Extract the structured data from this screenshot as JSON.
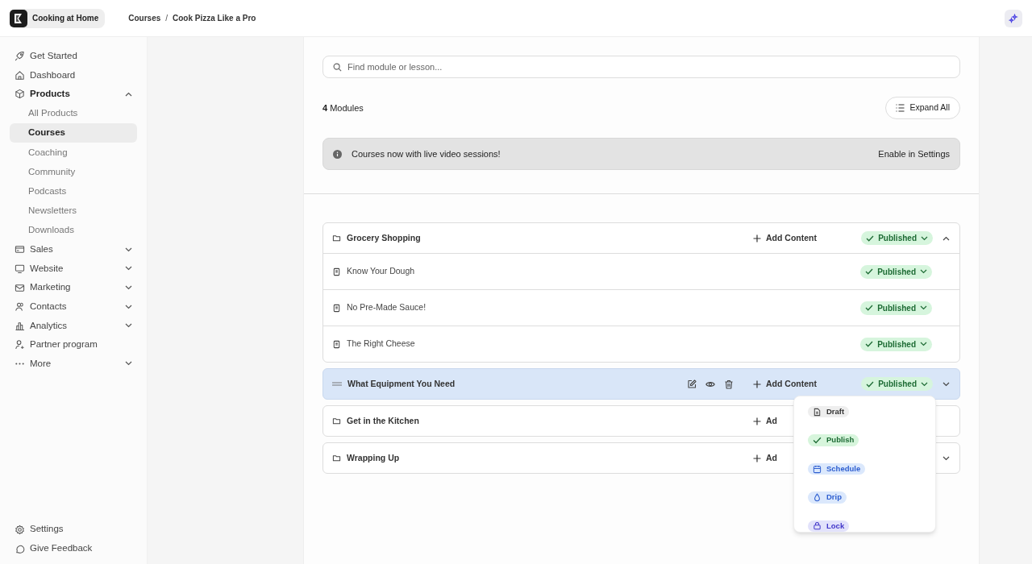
{
  "workspace": {
    "name": "Cooking at Home"
  },
  "breadcrumb": [
    "Courses",
    "Cook Pizza Like a Pro"
  ],
  "breadcrumb_separator": "/",
  "sidebar": {
    "items": [
      {
        "label": "Get Started",
        "selected": false
      },
      {
        "label": "Dashboard",
        "selected": false
      },
      {
        "label": "Products",
        "selected": false,
        "expanded": true,
        "children": [
          {
            "label": "All Products",
            "selected": false
          },
          {
            "label": "Courses",
            "selected": true
          },
          {
            "label": "Coaching",
            "selected": false
          },
          {
            "label": "Community",
            "selected": false
          },
          {
            "label": "Podcasts",
            "selected": false
          },
          {
            "label": "Newsletters",
            "selected": false
          },
          {
            "label": "Downloads",
            "selected": false
          }
        ]
      },
      {
        "label": "Sales",
        "selected": false,
        "expanded": false
      },
      {
        "label": "Website",
        "selected": false,
        "expanded": false
      },
      {
        "label": "Marketing",
        "selected": false,
        "expanded": false
      },
      {
        "label": "Contacts",
        "selected": false,
        "expanded": false
      },
      {
        "label": "Analytics",
        "selected": false,
        "expanded": false
      },
      {
        "label": "Partner program",
        "selected": false
      },
      {
        "label": "More",
        "selected": false,
        "expanded": false
      }
    ],
    "footer": [
      {
        "label": "Settings"
      },
      {
        "label": "Give Feedback"
      }
    ]
  },
  "search": {
    "placeholder": "Find module or lesson..."
  },
  "module_count": "**4** Modules",
  "expand_all": "Expand All",
  "banner": {
    "text": "Courses now with live video sessions!",
    "action": "Enable in Settings"
  },
  "modules": [
    {
      "title": "Grocery Shopping",
      "add": "Add Content",
      "status": "Published",
      "expanded": true,
      "highlighted": false,
      "lessons": [
        {
          "title": "Know Your Dough",
          "status": "Published"
        },
        {
          "title": "No Pre-Made Sauce!",
          "status": "Published"
        },
        {
          "title": "The Right Cheese",
          "status": "Published"
        }
      ]
    },
    {
      "title": "What Equipment You Need",
      "add": "Add Content",
      "status": "Published",
      "expanded": false,
      "highlighted": true
    },
    {
      "title": "Get in the Kitchen",
      "add": "Ad",
      "highlighted": false
    },
    {
      "title": "Wrapping Up",
      "add": "Ad",
      "expanded": false,
      "highlighted": false
    }
  ],
  "status_menu": [
    {
      "label": "Draft",
      "color": "#eeeeee"
    },
    {
      "label": "Publish",
      "color": "#d7f5dc"
    },
    {
      "label": "Schedule",
      "color": "#dbe8fc"
    },
    {
      "label": "Drip",
      "color": "#dbe8fc"
    },
    {
      "label": "Lock",
      "color": "#e2e2fb"
    }
  ]
}
